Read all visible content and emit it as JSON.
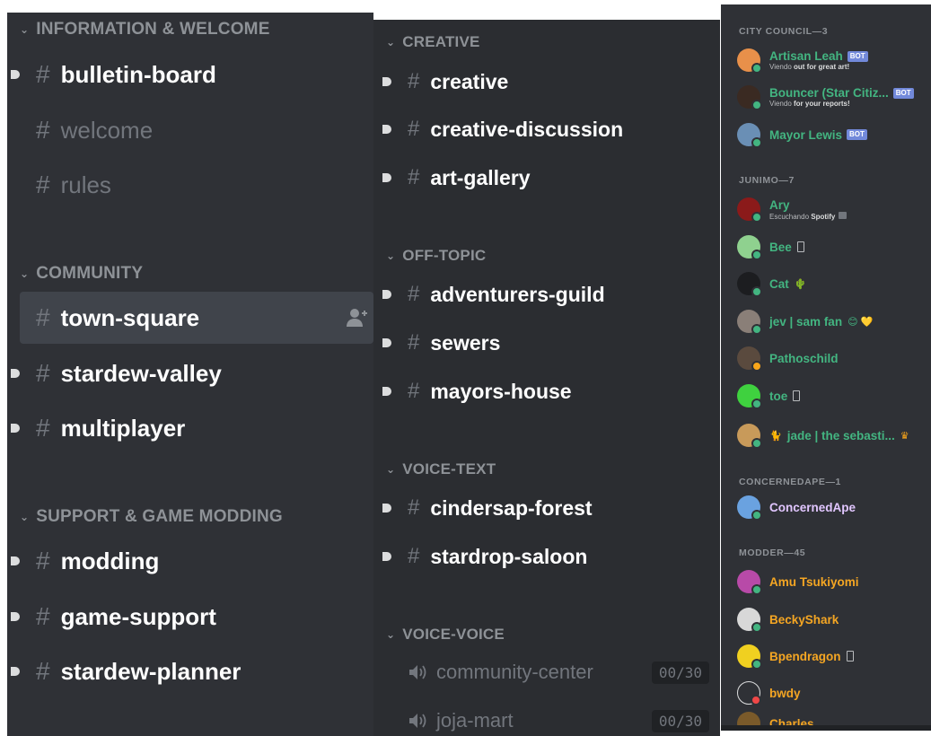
{
  "left": {
    "categories": [
      {
        "label": "INFORMATION & WELCOME"
      },
      {
        "label": "COMMUNITY"
      },
      {
        "label": "SUPPORT & GAME MODDING"
      }
    ],
    "channels": [
      {
        "label": "bulletin-board"
      },
      {
        "label": "welcome"
      },
      {
        "label": "rules"
      },
      {
        "label": "town-square"
      },
      {
        "label": "stardew-valley"
      },
      {
        "label": "multiplayer"
      },
      {
        "label": "modding"
      },
      {
        "label": "game-support"
      },
      {
        "label": "stardew-planner"
      }
    ]
  },
  "middle": {
    "categories": [
      {
        "label": "CREATIVE"
      },
      {
        "label": "OFF-TOPIC"
      },
      {
        "label": "VOICE-TEXT"
      },
      {
        "label": "VOICE-VOICE"
      }
    ],
    "channels": [
      {
        "label": "creative"
      },
      {
        "label": "creative-discussion"
      },
      {
        "label": "art-gallery"
      },
      {
        "label": "adventurers-guild"
      },
      {
        "label": "sewers"
      },
      {
        "label": "mayors-house"
      },
      {
        "label": "cindersap-forest"
      },
      {
        "label": "stardrop-saloon"
      }
    ],
    "voice": [
      {
        "label": "community-center",
        "count": "00/30"
      },
      {
        "label": "joja-mart",
        "count": "00/30"
      }
    ]
  },
  "members": {
    "groups": [
      {
        "label": "CITY COUNCIL—3"
      },
      {
        "label": "JUNIMO—7"
      },
      {
        "label": "CONCERNEDAPE—1"
      },
      {
        "label": "MODDER—45"
      }
    ],
    "bot_tag": "BOT",
    "list": [
      {
        "name": "Artisan Leah",
        "activity_prefix": "Viendo",
        "activity": "out for great art!"
      },
      {
        "name": "Bouncer (Star Citiz...",
        "activity_prefix": "Viendo",
        "activity": "for your reports!"
      },
      {
        "name": "Mayor Lewis"
      },
      {
        "name": "Ary",
        "activity_prefix": "Escuchando",
        "activity": "Spotify"
      },
      {
        "name": "Bee"
      },
      {
        "name": "Cat"
      },
      {
        "name": "jev | sam fan"
      },
      {
        "name": "Pathoschild"
      },
      {
        "name": "toe"
      },
      {
        "name": "jade | the sebasti..."
      },
      {
        "name": "ConcernedApe"
      },
      {
        "name": "Amu Tsukiyomi"
      },
      {
        "name": "BeckyShark"
      },
      {
        "name": "Bpendragon"
      },
      {
        "name": "bwdy"
      },
      {
        "name": "Charles"
      }
    ]
  },
  "colors": {
    "bg": "#2f3136",
    "selected": "#40444b",
    "online": "#43b581",
    "idle": "#faa61a",
    "dnd": "#f04747",
    "council": "#43b581",
    "junimo": "#43b581",
    "ape": "#e1c6ff",
    "modder": "#f5a623",
    "bot_tag": "#7289da"
  }
}
